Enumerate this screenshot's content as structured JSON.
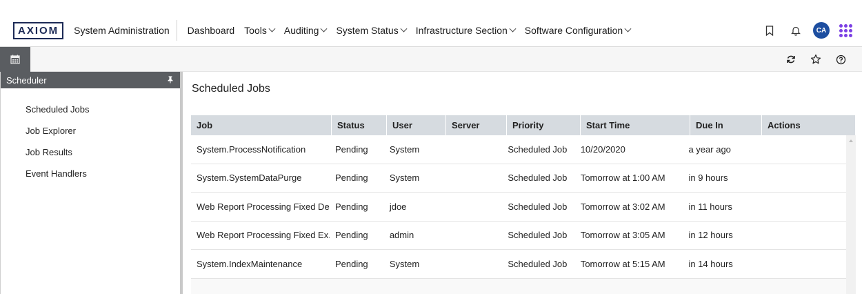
{
  "header": {
    "logo": "AXIOM",
    "app_title": "System Administration",
    "nav": [
      {
        "label": "Dashboard",
        "has_menu": false
      },
      {
        "label": "Tools",
        "has_menu": true
      },
      {
        "label": "Auditing",
        "has_menu": true
      },
      {
        "label": "System Status",
        "has_menu": true
      },
      {
        "label": "Infrastructure Section",
        "has_menu": true
      },
      {
        "label": "Software Configuration",
        "has_menu": true
      }
    ],
    "avatar_initials": "CA",
    "icons": [
      "bookmark-icon",
      "bell-icon",
      "apps-grid-icon"
    ]
  },
  "subbar": {
    "left_icon": "calendar-icon",
    "right_icons": [
      "refresh-icon",
      "star-icon",
      "help-icon"
    ]
  },
  "sidebar": {
    "title": "Scheduler",
    "pin_icon": "pin-icon",
    "items": [
      {
        "label": "Scheduled Jobs"
      },
      {
        "label": "Job Explorer"
      },
      {
        "label": "Job Results"
      },
      {
        "label": "Event Handlers"
      }
    ]
  },
  "main": {
    "title": "Scheduled Jobs",
    "columns": [
      "Job",
      "Status",
      "User",
      "Server",
      "Priority",
      "Start Time",
      "Due In",
      "Actions"
    ],
    "rows": [
      {
        "job": "System.ProcessNotification",
        "status": "Pending",
        "user": "System",
        "server": "",
        "priority": "Scheduled Job",
        "start": "10/20/2020",
        "due": "a year ago",
        "actions": ""
      },
      {
        "job": "System.SystemDataPurge",
        "status": "Pending",
        "user": "System",
        "server": "",
        "priority": "Scheduled Job",
        "start": "Tomorrow at 1:00 AM",
        "due": "in 9 hours",
        "actions": ""
      },
      {
        "job": "Web Report Processing Fixed De...",
        "status": "Pending",
        "user": "jdoe",
        "server": "",
        "priority": "Scheduled Job",
        "start": "Tomorrow at 3:02 AM",
        "due": "in 11 hours",
        "actions": ""
      },
      {
        "job": "Web Report Processing Fixed Ex...",
        "status": "Pending",
        "user": "admin",
        "server": "",
        "priority": "Scheduled Job",
        "start": "Tomorrow at 3:05 AM",
        "due": "in 12 hours",
        "actions": ""
      },
      {
        "job": "System.IndexMaintenance",
        "status": "Pending",
        "user": "System",
        "server": "",
        "priority": "Scheduled Job",
        "start": "Tomorrow at 5:15 AM",
        "due": "in 14 hours",
        "actions": ""
      }
    ]
  },
  "colors": {
    "brand": "#1c2a56",
    "avatar": "#1d4ea0",
    "apps_dots": "#7b3fe4",
    "panel_header": "#5a5d61",
    "grid_header": "#d6dbe0"
  }
}
